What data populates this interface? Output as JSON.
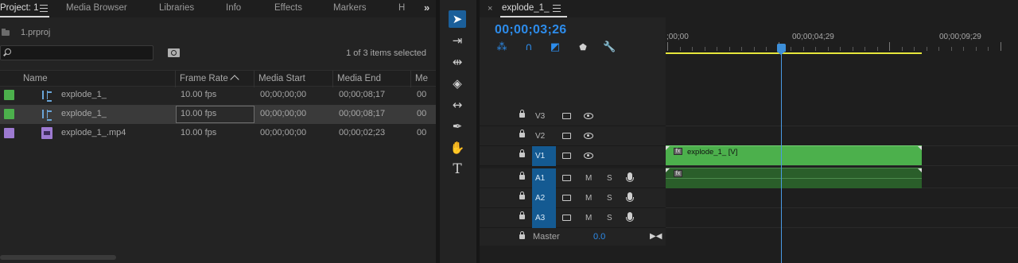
{
  "colors": {
    "accent_blue": "#2d8ceb",
    "video_clip": "#4cb04c",
    "audio_clip": "#2a5e2a",
    "workarea": "#e6e63c",
    "playhead": "#3d8fd9"
  },
  "project": {
    "tabs": [
      {
        "label": "Project: 1",
        "active": true
      },
      {
        "label": "Media Browser"
      },
      {
        "label": "Libraries"
      },
      {
        "label": "Info"
      },
      {
        "label": "Effects"
      },
      {
        "label": "Markers"
      },
      {
        "label": "H"
      }
    ],
    "overflow_icon": "double-chevron-right-icon",
    "file_name": "1.prproj",
    "search_placeholder": "",
    "selection_status": "1 of 3 items selected",
    "columns": [
      "Name",
      "Frame Rate",
      "Media Start",
      "Media End",
      "Me"
    ],
    "items": [
      {
        "color": "#4cb04c",
        "icon": "sequence-icon",
        "name": "explode_1_",
        "frame_rate": "10.00 fps",
        "media_start": "00;00;00;00",
        "media_end": "00;00;08;17",
        "extra": "00",
        "selected": false
      },
      {
        "color": "#4cb04c",
        "icon": "sequence-icon",
        "name": "explode_1_",
        "frame_rate": "10.00 fps",
        "media_start": "00;00;00;00",
        "media_end": "00;00;08;17",
        "extra": "00",
        "selected": true
      },
      {
        "color": "#9d7ad1",
        "icon": "video-file-icon",
        "name": "explode_1_.mp4",
        "frame_rate": "10.00 fps",
        "media_start": "00;00;00;00",
        "media_end": "00;00;02;23",
        "extra": "00",
        "selected": false
      }
    ]
  },
  "tools": [
    {
      "name": "selection-tool",
      "icon": "arrow-icon",
      "active": true
    },
    {
      "name": "track-select-forward-tool",
      "icon": "track-select-icon"
    },
    {
      "name": "ripple-edit-tool",
      "icon": "ripple-edit-icon"
    },
    {
      "name": "razor-tool",
      "icon": "razor-icon"
    },
    {
      "name": "slip-tool",
      "icon": "slip-icon"
    },
    {
      "name": "pen-tool",
      "icon": "pen-icon"
    },
    {
      "name": "hand-tool",
      "icon": "hand-icon"
    },
    {
      "name": "type-tool",
      "icon": "type-icon"
    }
  ],
  "timeline": {
    "tab_label": "explode_1_",
    "close_glyph": "×",
    "timecode": "00;00;03;26",
    "controls": [
      "nest-icon",
      "snap-icon",
      "linked-selection-icon",
      "add-marker-icon",
      "wrench-icon"
    ],
    "ruler_labels": [
      ";00;00",
      "00;00;04;29",
      "00;00;09;29"
    ],
    "video_tracks": [
      {
        "name": "V3",
        "targeted": false
      },
      {
        "name": "V2",
        "targeted": false
      },
      {
        "name": "V1",
        "targeted": true
      }
    ],
    "audio_tracks": [
      {
        "name": "A1",
        "targeted": true,
        "m": "M",
        "s": "S"
      },
      {
        "name": "A2",
        "targeted": true,
        "m": "M",
        "s": "S"
      },
      {
        "name": "A3",
        "targeted": true,
        "m": "M",
        "s": "S"
      }
    ],
    "master_label": "Master",
    "master_value": "0.0",
    "video_clip_label": "explode_1_ [V]",
    "fx_badge": "fx"
  }
}
